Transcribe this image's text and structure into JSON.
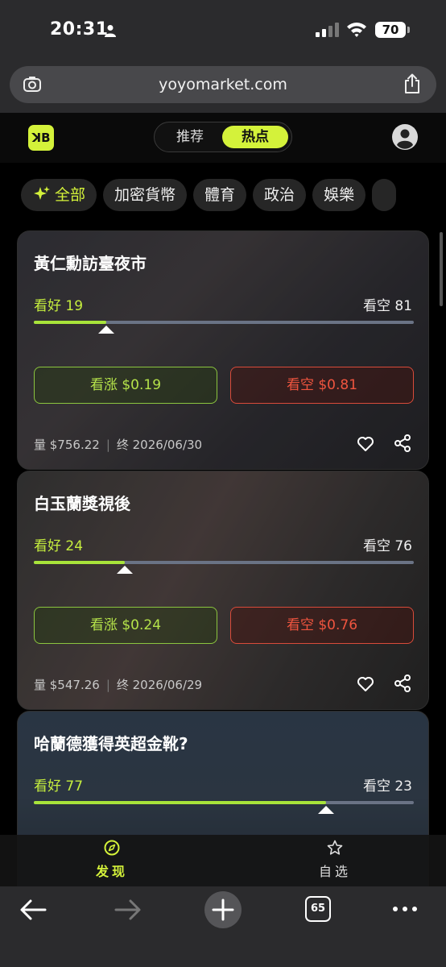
{
  "status_bar": {
    "time": "20:31",
    "battery": "70"
  },
  "browser": {
    "url": "yoyomarket.com",
    "tab_count": "65"
  },
  "header": {
    "logo_text": "ꓘB",
    "tabs": [
      {
        "label": "推荐",
        "active": false
      },
      {
        "label": "热点",
        "active": true
      }
    ]
  },
  "categories": [
    {
      "label": "全部",
      "active": true
    },
    {
      "label": "加密貨幣"
    },
    {
      "label": "體育"
    },
    {
      "label": "政治"
    },
    {
      "label": "娛樂"
    }
  ],
  "markets": [
    {
      "title": "黃仁勳訪臺夜市",
      "bull_label": "看好 19",
      "bear_label": "看空 81",
      "bull_pct": 19,
      "up_button": "看涨 $0.19",
      "down_button": "看空 $0.81",
      "volume": "量 $756.22",
      "end_date": "终 2026/06/30"
    },
    {
      "title": "白玉蘭獎視後",
      "bull_label": "看好 24",
      "bear_label": "看空 76",
      "bull_pct": 24,
      "up_button": "看涨 $0.24",
      "down_button": "看空 $0.76",
      "volume": "量 $547.26",
      "end_date": "终 2026/06/29"
    },
    {
      "title": "哈蘭德獲得英超金靴?",
      "bull_label": "看好 77",
      "bear_label": "看空 23",
      "bull_pct": 77
    }
  ],
  "bottom_nav": [
    {
      "label": "发现",
      "icon": "compass-icon",
      "active": true
    },
    {
      "label": "自选",
      "icon": "star-icon",
      "active": false
    }
  ],
  "colors": {
    "accent": "#d4f23a",
    "bull": "#a8e43a",
    "bear": "#f0553f"
  }
}
